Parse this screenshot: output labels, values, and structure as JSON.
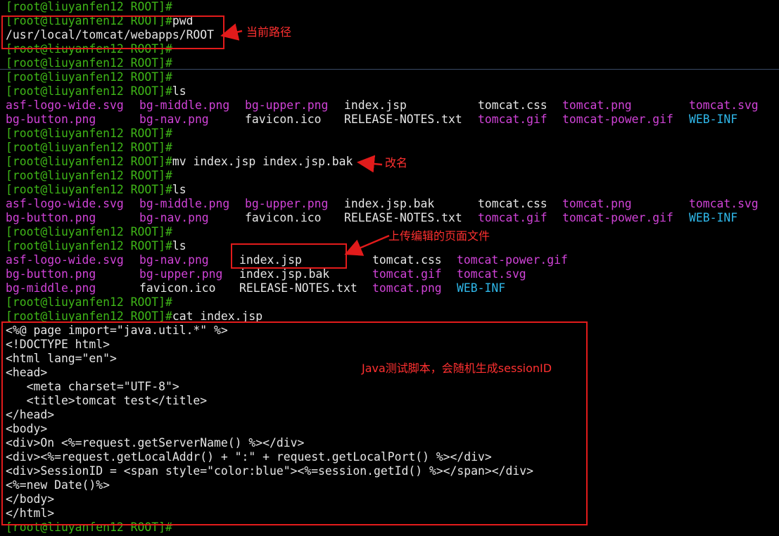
{
  "terminal": {
    "prompt": "[root@liuyanfen12 ROOT]#",
    "lines": [
      {
        "kind": "prompt",
        "cmd": ""
      },
      {
        "kind": "prompt",
        "cmd": "pwd"
      },
      {
        "kind": "out",
        "text": "/usr/local/tomcat/webapps/ROOT"
      },
      {
        "kind": "prompt",
        "cmd": ""
      },
      {
        "kind": "prompt",
        "cmd": ""
      },
      {
        "kind": "prompt",
        "cmd": ""
      },
      {
        "kind": "prompt",
        "cmd": "ls"
      },
      {
        "kind": "cols",
        "cells": [
          {
            "t": "asf-logo-wide.svg",
            "c": "pink"
          },
          {
            "t": "bg-middle.png",
            "c": "pink"
          },
          {
            "t": "bg-upper.png",
            "c": "pink"
          },
          {
            "t": "index.jsp",
            "c": "out"
          },
          {
            "t": "tomcat.css",
            "c": "out"
          },
          {
            "t": "tomcat.png",
            "c": "pink"
          },
          {
            "t": "tomcat.svg",
            "c": "pink"
          }
        ]
      },
      {
        "kind": "cols",
        "cells": [
          {
            "t": "bg-button.png",
            "c": "pink"
          },
          {
            "t": "bg-nav.png",
            "c": "pink"
          },
          {
            "t": "favicon.ico",
            "c": "out"
          },
          {
            "t": "RELEASE-NOTES.txt",
            "c": "out"
          },
          {
            "t": "tomcat.gif",
            "c": "pink"
          },
          {
            "t": "tomcat-power.gif",
            "c": "pink"
          },
          {
            "t": "WEB-INF",
            "c": "cyan"
          }
        ]
      },
      {
        "kind": "prompt",
        "cmd": ""
      },
      {
        "kind": "prompt",
        "cmd": ""
      },
      {
        "kind": "prompt",
        "cmd": "mv index.jsp index.jsp.bak"
      },
      {
        "kind": "prompt",
        "cmd": ""
      },
      {
        "kind": "prompt",
        "cmd": "ls"
      },
      {
        "kind": "cols",
        "cells": [
          {
            "t": "asf-logo-wide.svg",
            "c": "pink"
          },
          {
            "t": "bg-middle.png",
            "c": "pink"
          },
          {
            "t": "bg-upper.png",
            "c": "pink"
          },
          {
            "t": "index.jsp.bak",
            "c": "out"
          },
          {
            "t": "tomcat.css",
            "c": "out"
          },
          {
            "t": "tomcat.png",
            "c": "pink"
          },
          {
            "t": "tomcat.svg",
            "c": "pink"
          }
        ]
      },
      {
        "kind": "cols",
        "cells": [
          {
            "t": "bg-button.png",
            "c": "pink"
          },
          {
            "t": "bg-nav.png",
            "c": "pink"
          },
          {
            "t": "favicon.ico",
            "c": "out"
          },
          {
            "t": "RELEASE-NOTES.txt",
            "c": "out"
          },
          {
            "t": "tomcat.gif",
            "c": "pink"
          },
          {
            "t": "tomcat-power.gif",
            "c": "pink"
          },
          {
            "t": "WEB-INF",
            "c": "cyan"
          }
        ]
      },
      {
        "kind": "prompt",
        "cmd": ""
      },
      {
        "kind": "prompt",
        "cmd": "ls"
      },
      {
        "kind": "cols2",
        "cells": [
          {
            "t": "asf-logo-wide.svg",
            "c": "pink"
          },
          {
            "t": "bg-nav.png",
            "c": "pink"
          },
          {
            "t": "index.jsp",
            "c": "out"
          },
          {
            "t": "tomcat.css",
            "c": "out"
          },
          {
            "t": "tomcat-power.gif",
            "c": "pink"
          }
        ]
      },
      {
        "kind": "cols2",
        "cells": [
          {
            "t": "bg-button.png",
            "c": "pink"
          },
          {
            "t": "bg-upper.png",
            "c": "pink"
          },
          {
            "t": "index.jsp.bak",
            "c": "out"
          },
          {
            "t": "tomcat.gif",
            "c": "pink"
          },
          {
            "t": "tomcat.svg",
            "c": "pink"
          }
        ]
      },
      {
        "kind": "cols2",
        "cells": [
          {
            "t": "bg-middle.png",
            "c": "pink"
          },
          {
            "t": "favicon.ico",
            "c": "out"
          },
          {
            "t": "RELEASE-NOTES.txt",
            "c": "out"
          },
          {
            "t": "tomcat.png",
            "c": "pink"
          },
          {
            "t": "WEB-INF",
            "c": "cyan"
          }
        ]
      },
      {
        "kind": "prompt",
        "cmd": ""
      },
      {
        "kind": "prompt",
        "cmd": "cat index.jsp"
      },
      {
        "kind": "out",
        "text": "<%@ page import=\"java.util.*\" %>"
      },
      {
        "kind": "out",
        "text": "<!DOCTYPE html>"
      },
      {
        "kind": "out",
        "text": "<html lang=\"en\">"
      },
      {
        "kind": "out",
        "text": "<head>"
      },
      {
        "kind": "out",
        "text": "   <meta charset=\"UTF-8\">"
      },
      {
        "kind": "out",
        "text": "   <title>tomcat test</title>"
      },
      {
        "kind": "out",
        "text": "</head>"
      },
      {
        "kind": "out",
        "text": "<body>"
      },
      {
        "kind": "out",
        "text": "<div>On <%=request.getServerName() %></div>"
      },
      {
        "kind": "out",
        "text": "<div><%=request.getLocalAddr() + \":\" + request.getLocalPort() %></div>"
      },
      {
        "kind": "out",
        "text": "<div>SessionID = <span style=\"color:blue\"><%=session.getId() %></span></div>"
      },
      {
        "kind": "out",
        "text": "<%=new Date()%>"
      },
      {
        "kind": "out",
        "text": "</body>"
      },
      {
        "kind": "out",
        "text": "</html>"
      },
      {
        "kind": "prompt",
        "cmd": ""
      }
    ]
  },
  "annotations": {
    "current_path": "当前路径",
    "rename": "改名",
    "upload": "上传编辑的页面文件",
    "java_script": "Java测试脚本，会随机生成sessionID"
  },
  "colors": {
    "background": "#000000",
    "prompt": "#3fb618",
    "text": "#e6e6e6",
    "image_file": "#d043d7",
    "directory": "#2fb8ea",
    "annotation": "#e21b1b"
  }
}
